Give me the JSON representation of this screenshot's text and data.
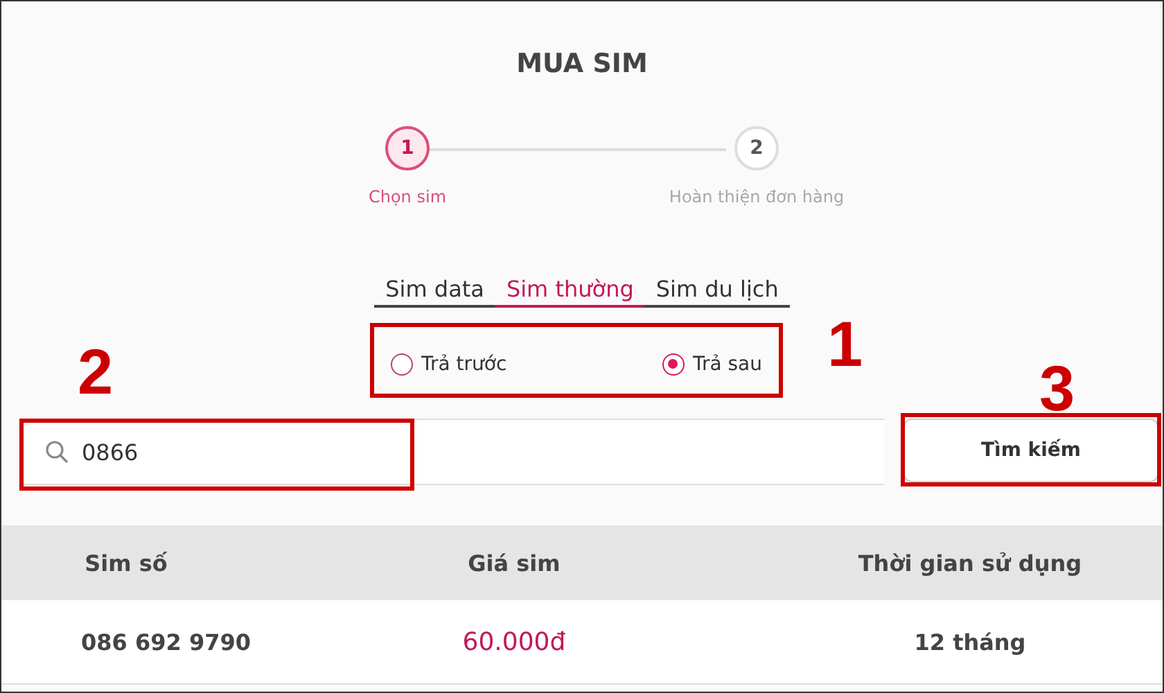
{
  "title": "MUA SIM",
  "steps": [
    {
      "number": "1",
      "label": "Chọn sim",
      "selected": true
    },
    {
      "number": "2",
      "label": "Hoàn thiện đơn hàng",
      "selected": false
    }
  ],
  "tabs": [
    {
      "label": "Sim data",
      "selected": false
    },
    {
      "label": "Sim thường",
      "selected": true
    },
    {
      "label": "Sim du lịch",
      "selected": false
    }
  ],
  "payment_options": [
    {
      "label": "Trả trước",
      "selected": false
    },
    {
      "label": "Trả sau",
      "selected": true
    }
  ],
  "search": {
    "value": "0866"
  },
  "search_button": "Tìm kiếm",
  "table": {
    "columns": [
      "Sim số",
      "Giá sim",
      "Thời gian sử dụng"
    ],
    "rows": [
      {
        "number": "086 692 9790",
        "price": "60.000đ",
        "duration": "12 tháng"
      }
    ]
  },
  "annotations": [
    {
      "label": "1"
    },
    {
      "label": "2"
    },
    {
      "label": "3"
    }
  ]
}
